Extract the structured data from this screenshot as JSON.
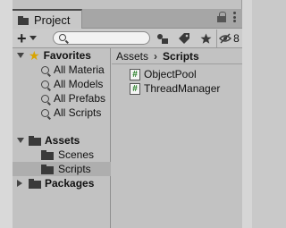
{
  "tab": {
    "title": "Project",
    "item_count": "8"
  },
  "search": {
    "placeholder": ""
  },
  "favorites": {
    "label": "Favorites",
    "items": [
      "All Materia",
      "All Models",
      "All Prefabs",
      "All Scripts"
    ]
  },
  "assets": {
    "label": "Assets",
    "children": [
      "Scenes",
      "Scripts"
    ]
  },
  "packages": {
    "label": "Packages"
  },
  "breadcrumb": [
    "Assets",
    "Scripts"
  ],
  "files": [
    "ObjectPool",
    "ThreadManager"
  ],
  "colors": {
    "favorite_star": "#d8a400",
    "script_hash": "#1d7a1d",
    "selected_row": "#aeaeae"
  }
}
